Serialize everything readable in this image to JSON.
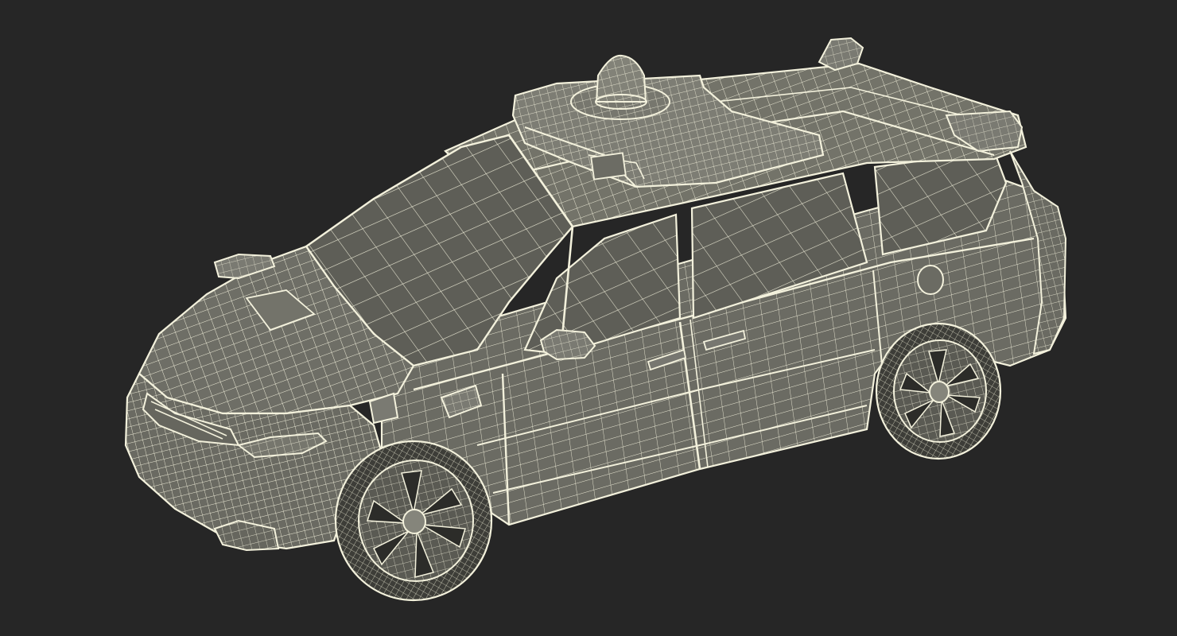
{
  "scene": {
    "subject": "wireframe-minivan-with-roof-sensor",
    "colors": {
      "background": "#262626",
      "surface": "#6e6e66",
      "surface_dark": "#55554e",
      "glass": "#5c5c55",
      "wire": "#f3f1dc",
      "wire_dim": "#d9d6c0",
      "tire": "#3a3a36"
    }
  }
}
